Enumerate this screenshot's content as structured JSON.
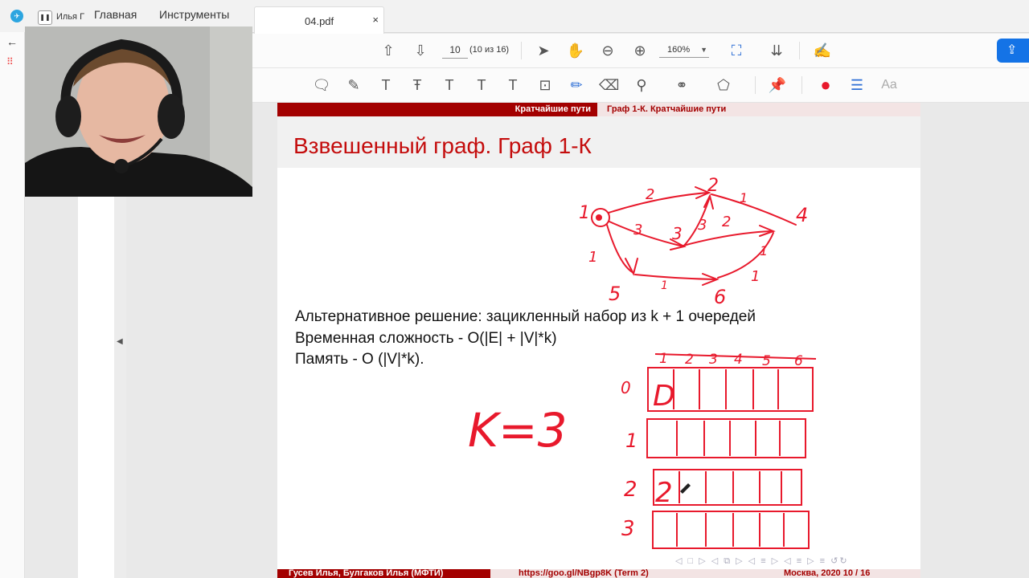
{
  "tabs": {
    "home": "Главная",
    "tools": "Инструменты",
    "user": "Илья Г"
  },
  "document": {
    "filename": "04.pdf",
    "close": "×"
  },
  "toolbar": {
    "page_current": "10",
    "page_total": "(10 из 16)",
    "zoom": "160%"
  },
  "slide": {
    "header_left": "Кратчайшие пути",
    "header_right": "Граф 1-К. Кратчайшие пути",
    "title": "Взвешенный граф. Граф 1-К",
    "lines": [
      "Альтернативное решение: зацикленный набор из k + 1 очередей",
      "Временная сложность - O(|E| + |V|*k)",
      "Память - O (|V|*k)."
    ],
    "footer_left": "Гусев Илья, Булгаков Илья (МФТИ)",
    "footer_mid": "https://goo.gl/NBgp8K (Term 2)",
    "footer_right": "Москва, 2020     10 / 16"
  },
  "annotations": {
    "k_label": "K=3",
    "node_labels": [
      "1",
      "2",
      "3",
      "4",
      "5",
      "6"
    ],
    "edge_weights": [
      "2",
      "3",
      "3",
      "2",
      "1",
      "1",
      "1",
      "1",
      "1"
    ],
    "queue_indices": [
      "0",
      "1",
      "2",
      "3"
    ],
    "column_labels": [
      "1",
      "2",
      "3",
      "4",
      "5",
      "6"
    ],
    "queue0_value": "D",
    "queue2_value": "2"
  },
  "colors": {
    "accent": "#a30000",
    "ink": "#e8192c",
    "title": "#c40d0d"
  }
}
